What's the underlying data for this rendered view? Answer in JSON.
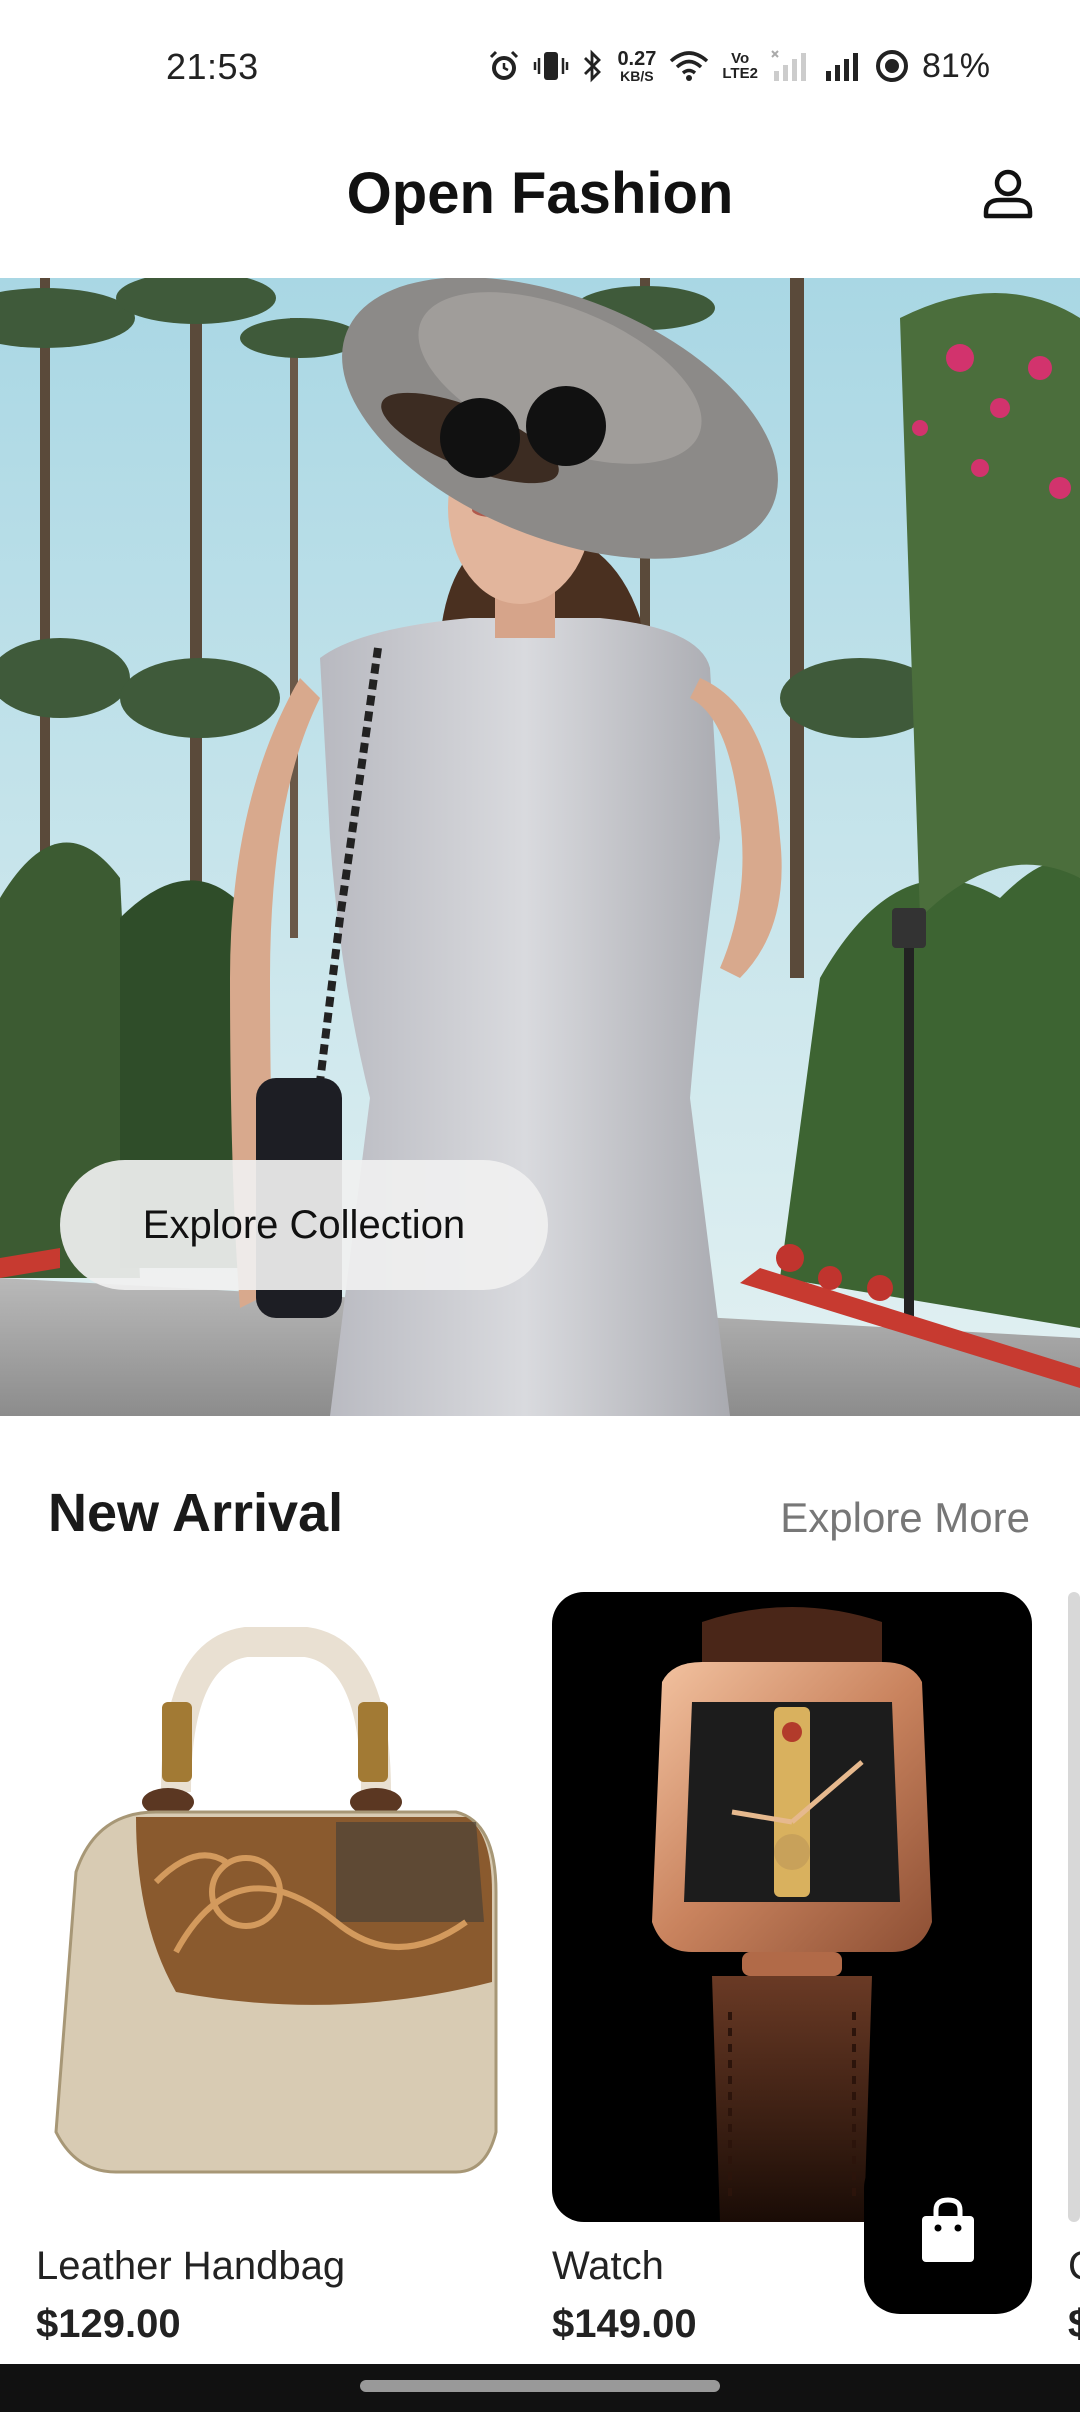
{
  "status_bar": {
    "time": "21:53",
    "net_speed_value": "0.27",
    "net_speed_unit": "KB/S",
    "volte_top": "Vo",
    "volte_bottom": "LTE2",
    "battery": "81%",
    "icons": [
      "alarm-icon",
      "vibrate-icon",
      "bluetooth-icon",
      "wifi-icon",
      "volte-icon",
      "signal-empty-icon",
      "signal-icon",
      "battery-ring-icon"
    ]
  },
  "header": {
    "title": "Open Fashion",
    "profile_icon": "user-icon"
  },
  "hero": {
    "cta_label": "Explore Collection"
  },
  "new_arrival": {
    "title": "New Arrival",
    "explore_more": "Explore More",
    "products": [
      {
        "name": "Leather Handbag",
        "price": "$129.00"
      },
      {
        "name": "Watch",
        "price": "$149.00"
      }
    ],
    "partial_product_letters": {
      "name_initial": "C",
      "price_initial": "$"
    }
  },
  "cart_icon": "shopping-bag-icon",
  "colors": {
    "primary": "#000000",
    "background": "#ffffff",
    "muted": "#777777"
  }
}
